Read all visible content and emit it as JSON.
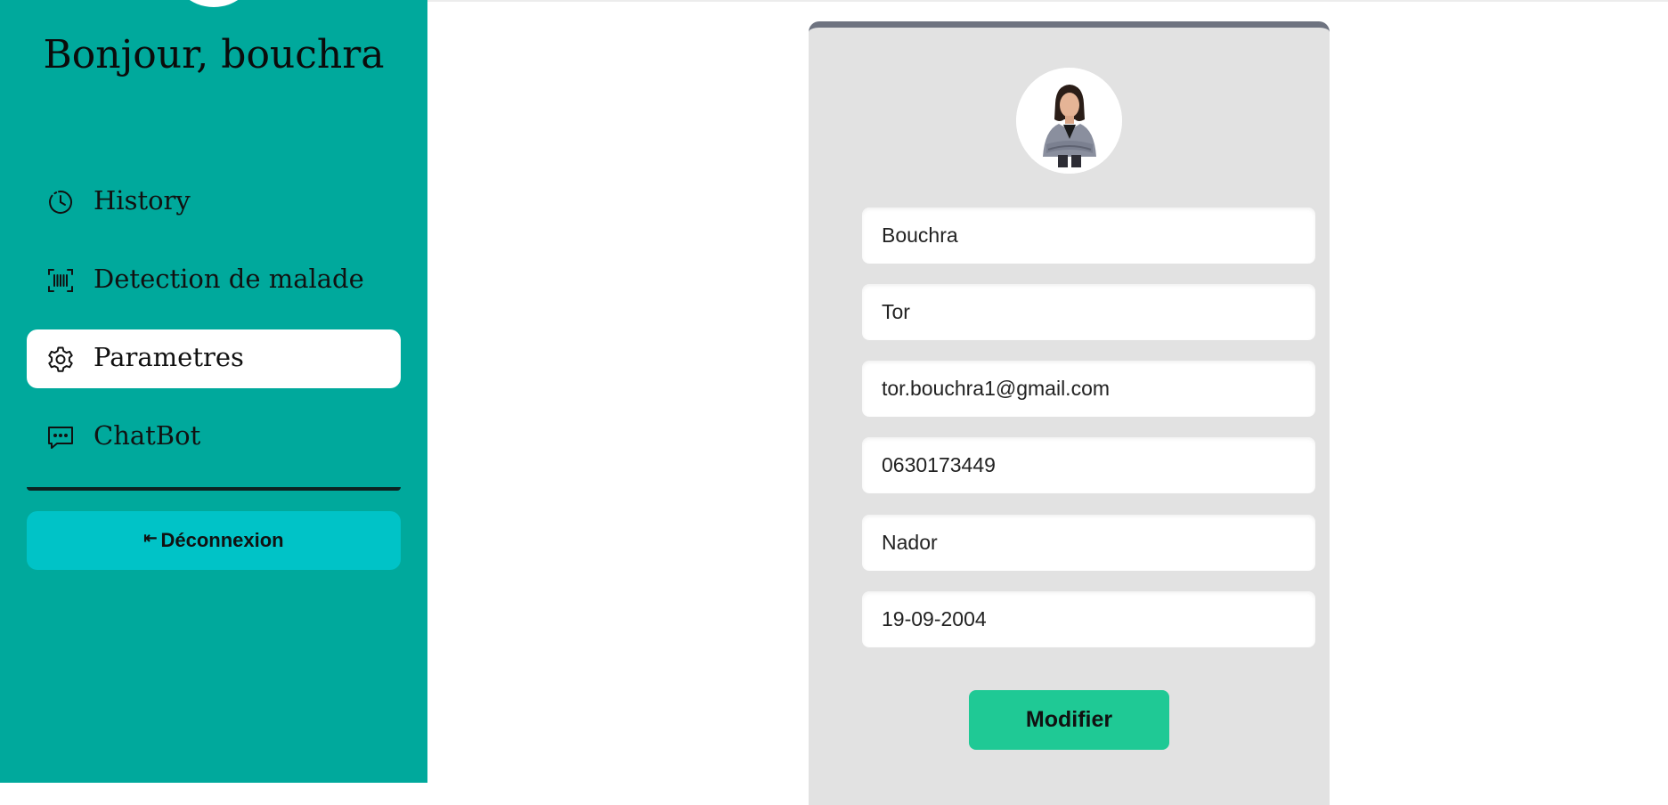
{
  "sidebar": {
    "greeting": "Bonjour, bouchra",
    "items": [
      {
        "label": "History",
        "icon": "history-icon",
        "active": false
      },
      {
        "label": "Detection de malade",
        "icon": "barcode-scan-icon",
        "active": false
      },
      {
        "label": "Parametres",
        "icon": "gear-icon",
        "active": true
      },
      {
        "label": "ChatBot",
        "icon": "chat-icon",
        "active": false
      }
    ],
    "logout": {
      "label": "Déconnexion",
      "icon": "logout-arrow-icon",
      "glyph": "⇤"
    }
  },
  "profile": {
    "photo_icon": "profile-photo",
    "fields": {
      "first_name": "Bouchra",
      "last_name": "Tor",
      "email": "tor.bouchra1@gmail.com",
      "phone": "0630173449",
      "city": "Nador",
      "birth_date": "19-09-2004"
    },
    "submit_label": "Modifier"
  },
  "colors": {
    "sidebar_bg": "#00a99c",
    "logout_bg": "#00c3c7",
    "card_bg": "#e2e2e2",
    "card_top_border": "#6e7380",
    "submit_bg": "#1fc995"
  }
}
